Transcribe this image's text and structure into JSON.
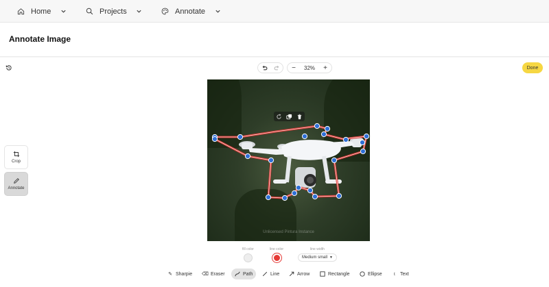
{
  "nav": {
    "home": "Home",
    "projects": "Projects",
    "annotate": "Annotate"
  },
  "header": {
    "title": "Annotate Image"
  },
  "toolbar": {
    "zoom": "32%",
    "zoom_out": "−",
    "zoom_in": "+",
    "done": "Done"
  },
  "side_tools": {
    "crop": "Crop",
    "annotate": "Annotate"
  },
  "canvas": {
    "watermark": "Unlicensed Pintura Instance"
  },
  "props": {
    "fill_color_label": "fill color",
    "line_color_label": "line color",
    "line_width_label": "line width",
    "line_width_value": "Medium small",
    "fill_color": "#eeeeee",
    "line_color": "#e53935"
  },
  "tools": {
    "sharpie": "Sharpie",
    "eraser": "Eraser",
    "path": "Path",
    "line": "Line",
    "arrow": "Arrow",
    "rectangle": "Rectangle",
    "ellipse": "Ellipse",
    "text": "Text"
  },
  "colors": {
    "accent": "#f6d743",
    "annotation": "#e53935",
    "handle": "#2f6fd6"
  }
}
